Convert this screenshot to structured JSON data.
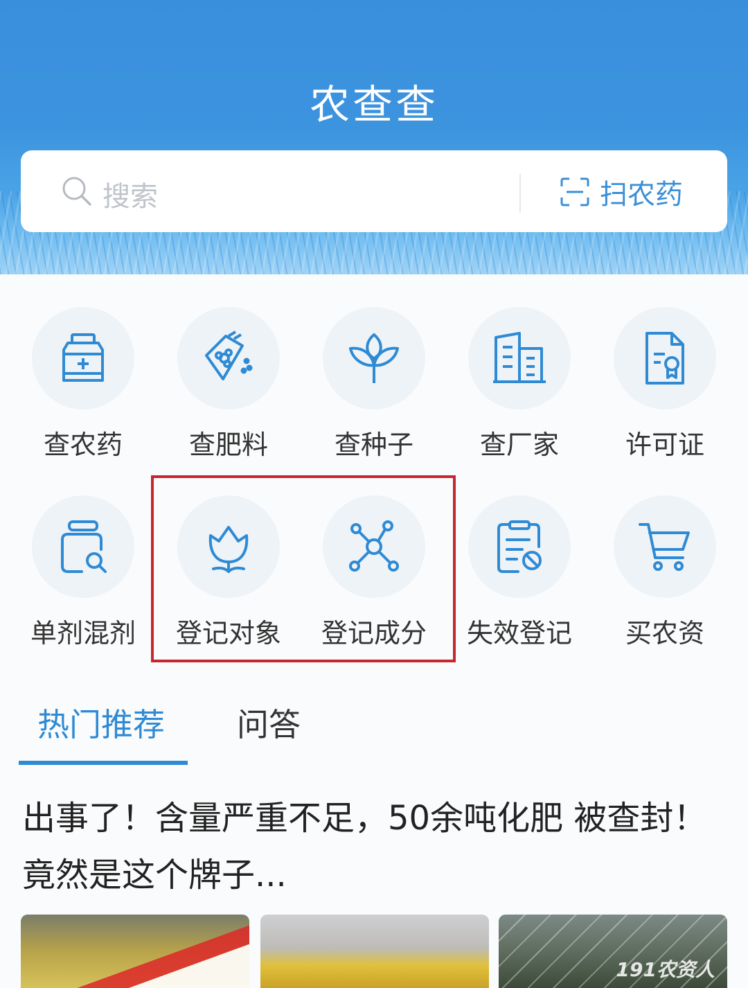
{
  "header": {
    "title": "农查查",
    "search_placeholder": "搜索",
    "scan_label": "扫农药"
  },
  "grid": {
    "row1": [
      {
        "label": "查农药",
        "icon": "pesticide-bottle-icon"
      },
      {
        "label": "查肥料",
        "icon": "fertilizer-bag-icon"
      },
      {
        "label": "查种子",
        "icon": "seedling-icon"
      },
      {
        "label": "查厂家",
        "icon": "building-icon"
      },
      {
        "label": "许可证",
        "icon": "certificate-icon"
      }
    ],
    "row2": [
      {
        "label": "单剂混剂",
        "icon": "bottle-search-icon"
      },
      {
        "label": "登记对象",
        "icon": "flower-icon"
      },
      {
        "label": "登记成分",
        "icon": "molecule-icon"
      },
      {
        "label": "失效登记",
        "icon": "clipboard-forbidden-icon"
      },
      {
        "label": "买农资",
        "icon": "cart-icon"
      }
    ]
  },
  "tabs": {
    "hot": "热门推荐",
    "qa": "问答"
  },
  "article": {
    "title": "出事了！含量严重不足，50余吨化肥 被查封！竟然是这个牌子..."
  },
  "watermark": "191农资人",
  "colors": {
    "accent": "#2f8ad4",
    "header": "#3a8fdc",
    "highlight": "#c8262e"
  }
}
